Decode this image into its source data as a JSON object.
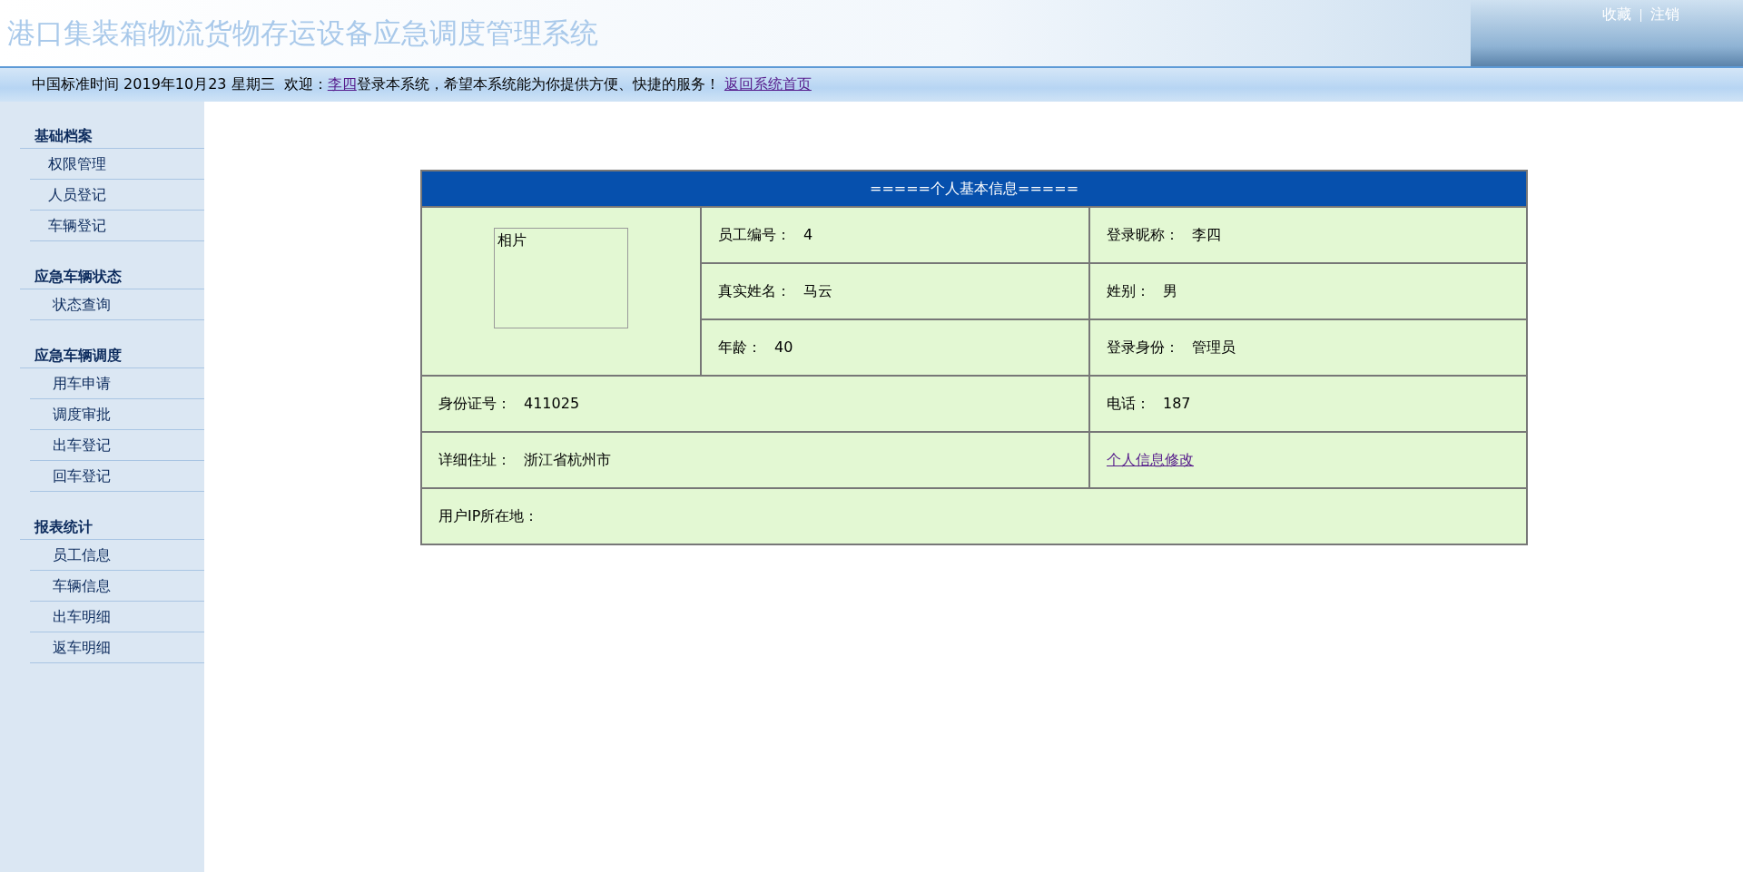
{
  "header": {
    "title": "港口集装箱物流货物存运设备应急调度管理系统",
    "links": [
      "收藏",
      "注销"
    ]
  },
  "info_bar": {
    "date_text": "中国标准时间 2019年10月23 星期三  欢迎：",
    "user": "李四",
    "message": "登录本系统，希望本系统能为你提供方便、快捷的服务！",
    "home_link": "返回系统首页"
  },
  "sidebar": {
    "groups": [
      {
        "title": "基础档案",
        "items": [
          "权限管理",
          "人员登记",
          "车辆登记"
        ]
      },
      {
        "title": "应急车辆状态",
        "items": [
          "状态查询"
        ]
      },
      {
        "title": "应急车辆调度",
        "items": [
          "用车申请",
          "调度审批",
          "出车登记",
          "回车登记"
        ]
      },
      {
        "title": "报表统计",
        "items": [
          "员工信息",
          "车辆信息",
          "出车明细",
          "返车明细"
        ]
      }
    ]
  },
  "profile": {
    "title": "=====个人基本信息=====",
    "photo_label": "相片",
    "fields": [
      {
        "label": "员工编号：",
        "value": "4"
      },
      {
        "label": "登录昵称：",
        "value": "李四"
      },
      {
        "label": "真实姓名：",
        "value": "马云"
      },
      {
        "label": "姓别：",
        "value": "男"
      },
      {
        "label": "年龄：",
        "value": "40"
      },
      {
        "label": "登录身份：",
        "value": "管理员"
      }
    ],
    "id_number": {
      "label": "身份证号：",
      "value": "411025"
    },
    "phone": {
      "label": "电话：",
      "value": "187"
    },
    "address": {
      "label": "详细住址：",
      "value": "浙江省杭州市"
    },
    "edit_link": "个人信息修改",
    "ip": {
      "label": "用户IP所在地："
    }
  }
}
